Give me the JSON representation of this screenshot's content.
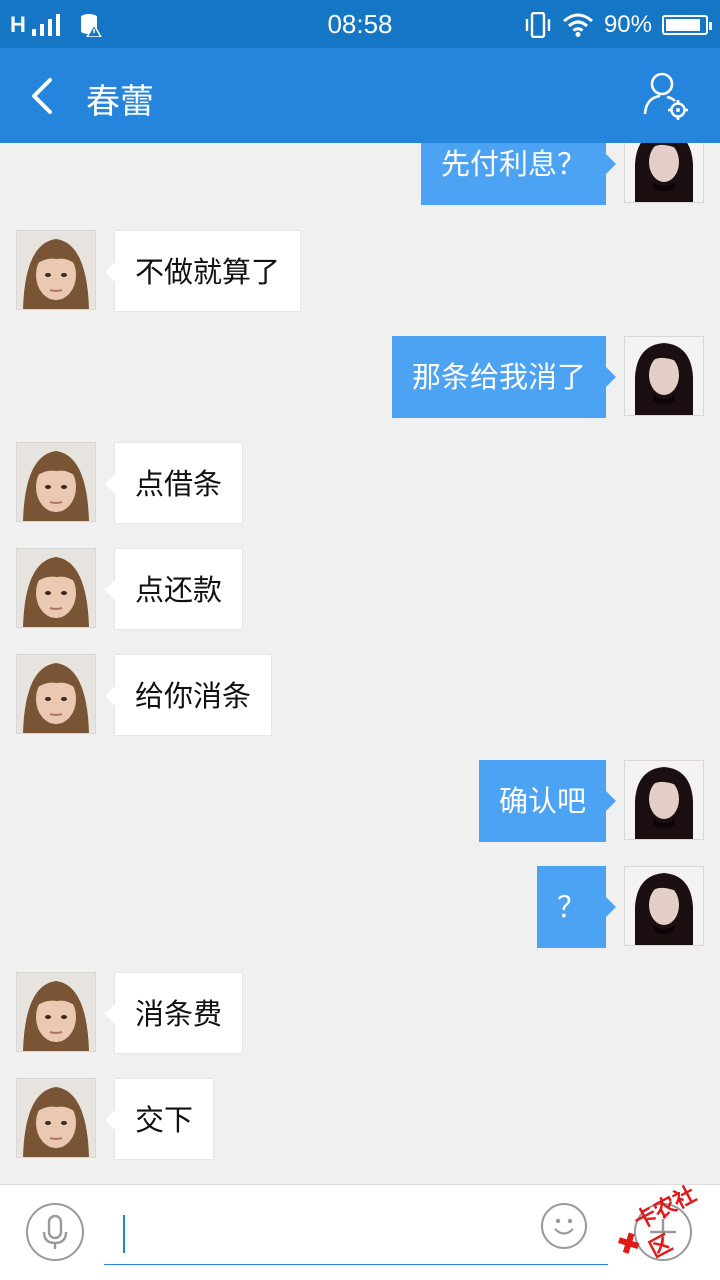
{
  "status_bar": {
    "network": "H",
    "time": "08:58",
    "battery_percent": "90%",
    "battery_level": 0.9,
    "icons": [
      "signal-icon",
      "data-icon",
      "vibrate-icon",
      "wifi-icon",
      "battery-icon"
    ]
  },
  "header": {
    "title": "春蕾",
    "back_icon": "chevron-left-icon",
    "profile_icon": "contact-settings-icon"
  },
  "messages": [
    {
      "side": "right",
      "text": "先付利息？"
    },
    {
      "side": "left",
      "text": "不做就算了"
    },
    {
      "side": "right",
      "text": "那条给我消了"
    },
    {
      "side": "left",
      "text": "点借条"
    },
    {
      "side": "left",
      "text": "点还款"
    },
    {
      "side": "left",
      "text": "给你消条"
    },
    {
      "side": "right",
      "text": "确认吧"
    },
    {
      "side": "right",
      "text": "？"
    },
    {
      "side": "left",
      "text": "消条费"
    },
    {
      "side": "left",
      "text": "交下"
    }
  ],
  "input_bar": {
    "value": "",
    "icons": [
      "microphone-icon",
      "emoji-icon",
      "plus-icon"
    ]
  },
  "watermark": {
    "text": "卡农社区"
  },
  "colors": {
    "status_bar": "#1476c4",
    "header": "#2584dc",
    "outgoing_bubble": "#4ca2f3",
    "incoming_bubble": "#ffffff",
    "background": "#f1f0f1"
  }
}
